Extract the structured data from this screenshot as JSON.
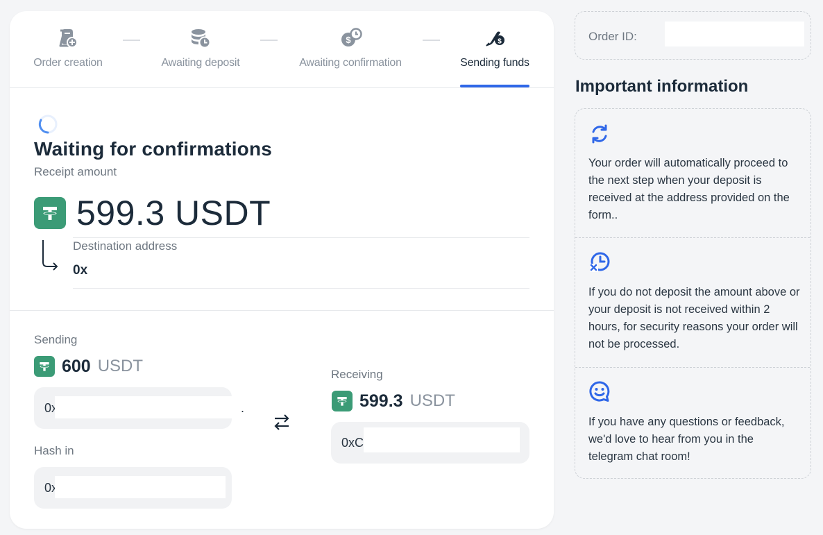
{
  "steps": [
    {
      "label": "Order creation",
      "icon": "order-create-icon",
      "state": "done"
    },
    {
      "label": "Awaiting deposit",
      "icon": "coins-clock-icon",
      "state": "done"
    },
    {
      "label": "Awaiting confirmation",
      "icon": "dollar-clock-icon",
      "state": "done"
    },
    {
      "label": "Sending funds",
      "icon": "send-dollar-icon",
      "state": "active"
    }
  ],
  "status": {
    "title": "Waiting for confirmations",
    "receipt_label": "Receipt amount",
    "receipt_amount": "599.3 USDT",
    "destination_label": "Destination address",
    "destination_value": "0x"
  },
  "sending": {
    "label": "Sending",
    "amount": "600",
    "currency": "USDT",
    "address_prefix": "0x",
    "address_suffix": ".",
    "hash_label": "Hash in",
    "hash_prefix": "0x"
  },
  "receiving": {
    "label": "Receiving",
    "amount": "599.3",
    "currency": "USDT",
    "address_prefix": "0xC"
  },
  "order": {
    "label": "Order ID:"
  },
  "info": {
    "title": "Important information",
    "items": [
      {
        "icon": "refresh-icon",
        "text": "Your order will automatically proceed to the next step when your deposit is received at the address provided on the form.."
      },
      {
        "icon": "clock-cancel-icon",
        "text": "If you do not deposit the amount above or your deposit is not received within 2 hours, for security reasons your order will not be processed."
      },
      {
        "icon": "chat-smile-icon",
        "text": "If you have any questions or feedback, we'd love to hear from you in the telegram chat room!"
      }
    ]
  },
  "colors": {
    "accent": "#2f67e8",
    "tether": "#3b9b76",
    "text": "#1c2b3a",
    "muted": "#6f7882"
  }
}
